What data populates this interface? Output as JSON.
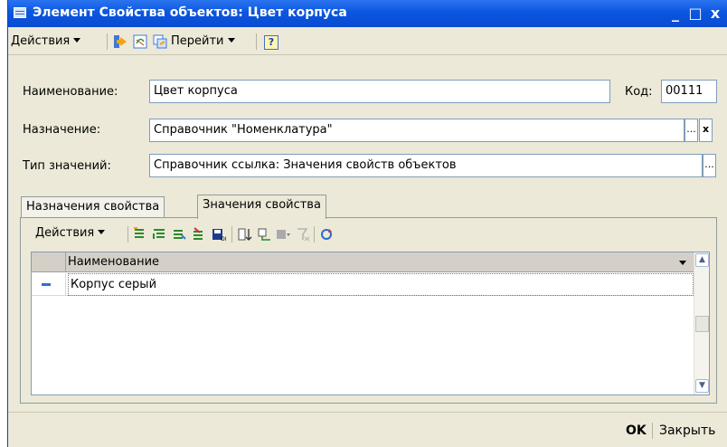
{
  "window": {
    "title": "Элемент Свойства объектов: Цвет корпуса",
    "minimize": "_",
    "maximize": "□",
    "close": "x"
  },
  "toolbar": {
    "actions_label": "Действия",
    "goto_label": "Перейти",
    "help_label": "?"
  },
  "form": {
    "name_label": "Наименование:",
    "name_value": "Цвет корпуса",
    "code_label": "Код:",
    "code_value": "00111",
    "purpose_label": "Назначение:",
    "purpose_value": "Справочник \"Номенклатура\"",
    "type_label": "Тип значений:",
    "type_value": "Справочник ссылка: Значения свойств объектов",
    "select_btn": "...",
    "clear_btn": "x"
  },
  "tabs": [
    {
      "label": "Назначения свойства",
      "active": false
    },
    {
      "label": "Значения свойства",
      "active": true
    }
  ],
  "panel_toolbar": {
    "actions_label": "Действия"
  },
  "grid": {
    "columns": [
      "Наименование"
    ],
    "rows": [
      {
        "name": "Корпус серый"
      }
    ]
  },
  "footer": {
    "ok_label": "OK",
    "close_label": "Закрыть"
  },
  "colors": {
    "titlebar": "#0b56e0",
    "window_bg": "#ece9d8",
    "field_border": "#7f9db9"
  }
}
